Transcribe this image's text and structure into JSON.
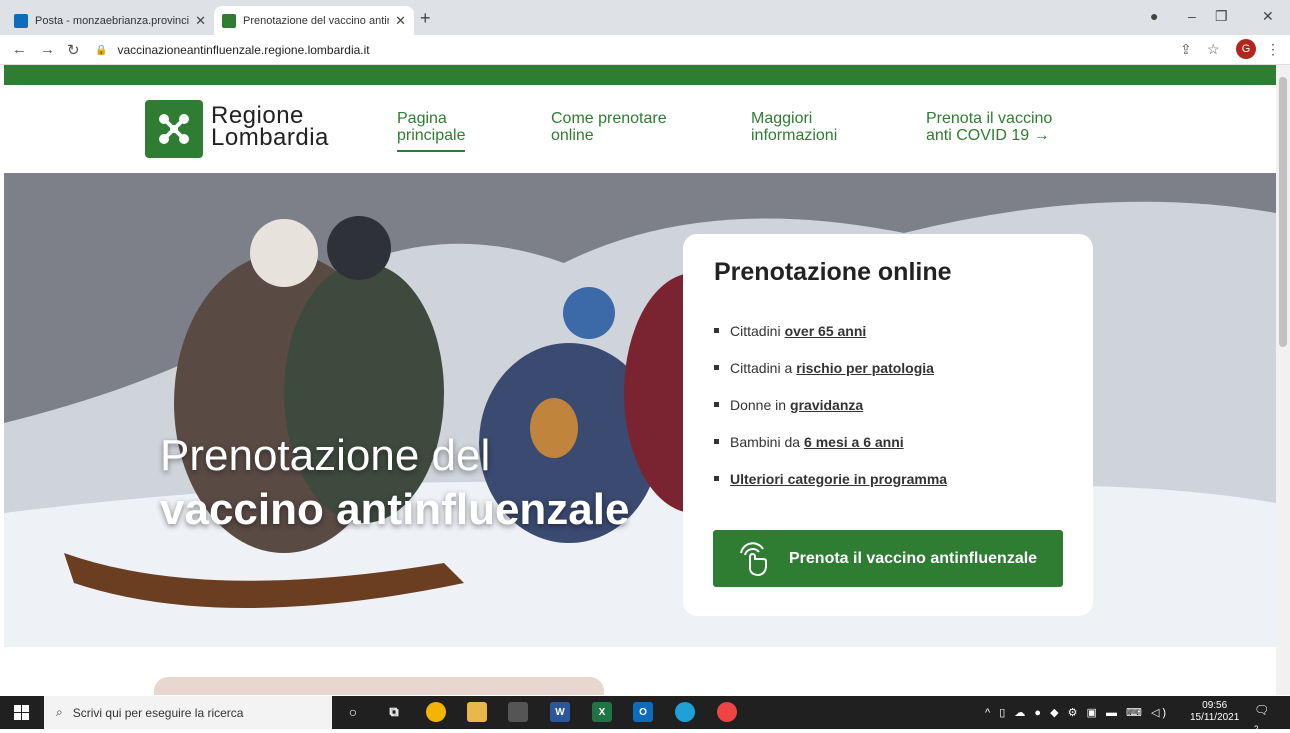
{
  "browser": {
    "tabs": [
      {
        "title": "Posta - monzaebrianza.provincia.",
        "icon": "outlook-icon"
      },
      {
        "title": "Prenotazione del vaccino antinflu",
        "icon": "regione-lombardia-icon"
      }
    ],
    "url": "vaccinazioneantinfluenzale.regione.lombardia.it",
    "profile_initial": "G"
  },
  "site": {
    "logo": {
      "line1": "Regione",
      "line2": "Lombardia"
    },
    "nav": [
      {
        "line1": "Pagina",
        "line2": "principale",
        "active": true
      },
      {
        "line1": "Come prenotare",
        "line2": "online",
        "active": false
      },
      {
        "line1": "Maggiori",
        "line2": "informazioni",
        "active": false
      },
      {
        "line1": "Prenota il vaccino",
        "line2": "anti COVID 19 →",
        "active": false
      }
    ],
    "hero": {
      "title_line1": "Prenotazione del",
      "title_line2": "vaccino antinfluenzale"
    },
    "card": {
      "title": "Prenotazione online",
      "items": [
        {
          "prefix": "Cittadini",
          "link": "over 65 anni"
        },
        {
          "prefix": "Cittadini a",
          "link": "rischio per patologia"
        },
        {
          "prefix": "Donne in",
          "link": "gravidanza"
        },
        {
          "prefix": "Bambini da",
          "link": "6 mesi a 6 anni"
        },
        {
          "prefix": "",
          "link": "Ulteriori categorie in programma"
        }
      ],
      "cta": "Prenota il vaccino antinfluenzale"
    }
  },
  "taskbar": {
    "search_placeholder": "Scrivi qui per eseguire la ricerca",
    "time": "09:56",
    "date": "15/11/2021",
    "notifications": "2"
  },
  "colors": {
    "brand_green": "#2e7d32",
    "taskbar_bg": "#202020"
  }
}
